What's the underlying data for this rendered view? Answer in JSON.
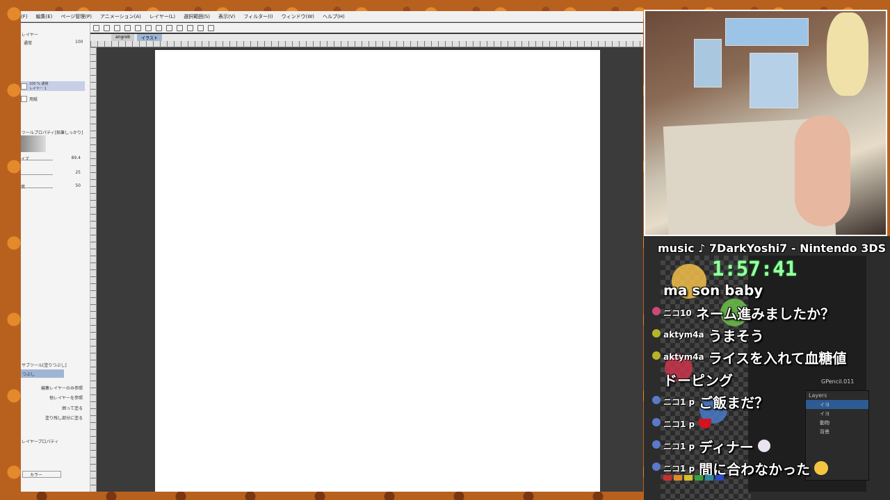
{
  "menu": [
    "(F)",
    "編集(E)",
    "ページ管理(P)",
    "アニメーション(A)",
    "レイヤー(L)",
    "選択範囲(S)",
    "表示(V)",
    "フィルター(I)",
    "ウィンドウ(W)",
    "ヘルプ(H)"
  ],
  "left_panel": {
    "layer_title": "レイヤー",
    "blend_mode": "通常",
    "opacity": "100",
    "layers": [
      {
        "label": "100 % 通常\nレイヤー 1",
        "selected": true
      },
      {
        "label": "用紙",
        "selected": false
      }
    ],
    "tool_property_title": "ツールプロパティ[鉛筆しっかり]",
    "brush_size_label": "イズ",
    "brush_size_value": "89.4",
    "value_2": "25",
    "density_label": "度",
    "density_value": "50",
    "sub_tool_title": "サブツール[塗りつぶし]",
    "sub_tool_selected": "つぶし",
    "fill_options": [
      "編集レイヤーのみ参照",
      "他レイヤーを参照",
      "囲って塗る",
      "塗り残し部分に塗る"
    ],
    "layer_property_title": "レイヤープロパティ",
    "color_label": "カラー"
  },
  "tabs": [
    "angrob",
    "イラスト"
  ],
  "overlay": {
    "music_text": "music ♪ 7DarkYoshi7 - Nintendo 3DS",
    "timer": "1:57:41",
    "gp_label": "GPencil.011",
    "layers_title": "Layers",
    "layer_items": [
      "イヨ",
      "イヨ",
      "動物",
      "背景"
    ]
  },
  "chat": [
    {
      "user": "",
      "text": "ma son baby"
    },
    {
      "user": "ニコ10",
      "text": "ネーム進みましたか？"
    },
    {
      "user": "aktym4a",
      "text": "うまそう"
    },
    {
      "user": "aktym4a",
      "text": "ライスを入れて血糖値"
    },
    {
      "user": "",
      "text": "ドーピング"
    },
    {
      "user": "ニコ1 p",
      "text": "ご飯まだ？"
    },
    {
      "user": "ニコ1 p",
      "text": ""
    },
    {
      "user": "ニコ1 p",
      "text": "ディナー"
    },
    {
      "user": "ニコ1 p",
      "text": "間に合わなかった"
    }
  ],
  "colors": {
    "accent": "#9affa2",
    "selection": "#2d5b93",
    "canvas": "#ffffff"
  }
}
